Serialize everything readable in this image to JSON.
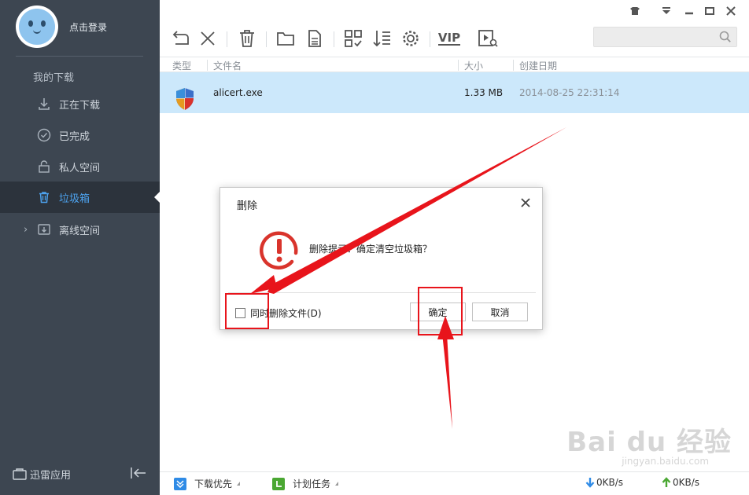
{
  "user": {
    "login_label": "点击登录"
  },
  "sidebar": {
    "heading": "我的下载",
    "items": [
      {
        "label": "正在下载",
        "icon": "download-arrow-icon"
      },
      {
        "label": "已完成",
        "icon": "check-circle-icon"
      },
      {
        "label": "私人空间",
        "icon": "lock-icon"
      },
      {
        "label": "垃圾箱",
        "icon": "trash-icon",
        "active": true
      },
      {
        "label": "离线空间",
        "icon": "cloud-download-icon"
      }
    ],
    "apps_label": "迅雷应用"
  },
  "toolbar": {
    "tools": [
      "back-icon",
      "close-icon",
      "trash-icon",
      "folder-icon",
      "document-icon",
      "grid-check-icon",
      "sort-icon",
      "gear-icon",
      "vip-icon",
      "play-search-icon"
    ],
    "vip_label": "VIP"
  },
  "search": {
    "placeholder": ""
  },
  "table": {
    "headers": {
      "type": "类型",
      "name": "文件名",
      "size": "大小",
      "date": "创建日期"
    },
    "rows": [
      {
        "name": "alicert.exe",
        "size": "1.33 MB",
        "date": "2014-08-25 22:31:14"
      }
    ]
  },
  "statusbar": {
    "priority_label": "下载优先",
    "schedule_label": "计划任务",
    "down_speed": "0KB/s",
    "up_speed": "0KB/s"
  },
  "dialog": {
    "title": "删除",
    "message": "删除提示：确定清空垃圾箱？",
    "checkbox_label": "同时删除文件(D)",
    "ok_label": "确定",
    "cancel_label": "取消"
  },
  "watermark": {
    "logo": "Bai du 经验",
    "url": "jingyan.baidu.com"
  },
  "colors": {
    "sidebar_bg": "#3d4651",
    "accent": "#4da3ef",
    "selected_row": "#cce8fb",
    "annotation": "#e8141b"
  }
}
